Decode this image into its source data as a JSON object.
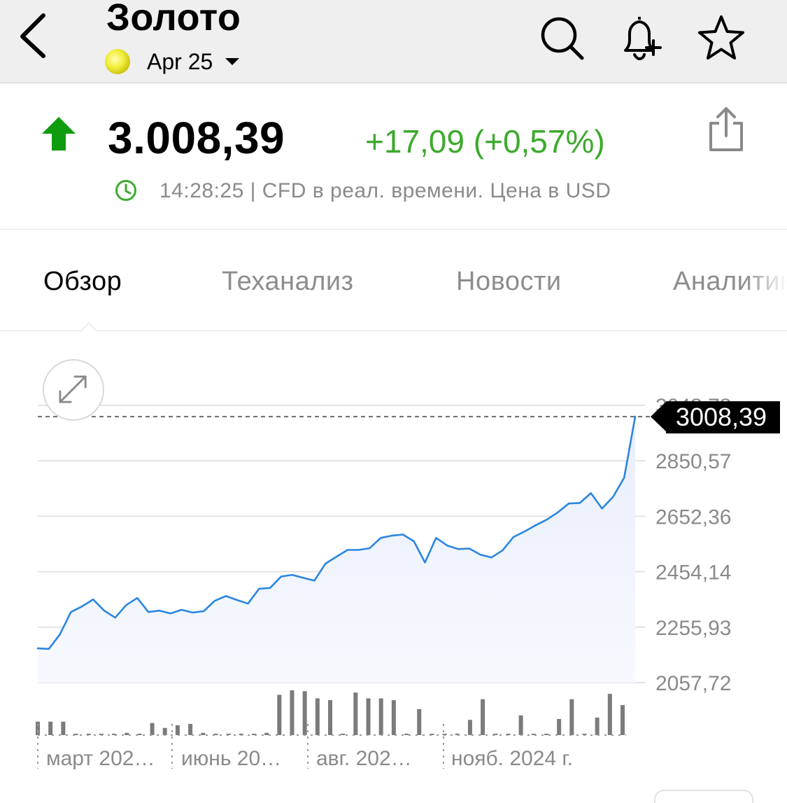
{
  "header": {
    "title": "Золото",
    "contract": "Apr 25"
  },
  "quote": {
    "price": "3.008,39",
    "change": "+17,09 (+0,57%)",
    "meta": "14:28:25 | CFD в реал. времени. Цена в USD",
    "direction": "up"
  },
  "tabs": [
    {
      "label": "Обзор",
      "active": true
    },
    {
      "label": "Теханализ",
      "active": false
    },
    {
      "label": "Новости",
      "active": false
    },
    {
      "label": "Аналитика",
      "active": false
    }
  ],
  "colors": {
    "up": "#3daa2d",
    "arrow": "#0f9d0f",
    "line": "#2a86e0",
    "volume": "#7b7b7b",
    "badge": "#000000"
  },
  "chart_data": {
    "type": "line",
    "current_value": 3008.39,
    "current_label": "3008,39",
    "y_ticks": [
      {
        "value": 3048.78,
        "label": "3048,78"
      },
      {
        "value": 2850.57,
        "label": "2850,57"
      },
      {
        "value": 2652.36,
        "label": "2652,36"
      },
      {
        "value": 2454.14,
        "label": "2454,14"
      },
      {
        "value": 2255.93,
        "label": "2255,93"
      },
      {
        "value": 2057.72,
        "label": "2057,72"
      }
    ],
    "ylim": [
      2057.72,
      3048.78
    ],
    "x_labels": [
      "март 202…",
      "июнь 20…",
      "авг. 202…",
      "нояб. 2024 г."
    ],
    "values": [
      2180,
      2178,
      2230,
      2310,
      2330,
      2355,
      2315,
      2290,
      2335,
      2360,
      2310,
      2315,
      2305,
      2318,
      2308,
      2313,
      2350,
      2367,
      2353,
      2340,
      2393,
      2396,
      2437,
      2443,
      2432,
      2422,
      2483,
      2508,
      2532,
      2532,
      2538,
      2575,
      2583,
      2587,
      2563,
      2487,
      2575,
      2548,
      2535,
      2537,
      2515,
      2505,
      2530,
      2578,
      2598,
      2620,
      2640,
      2666,
      2698,
      2700,
      2735,
      2680,
      2722,
      2790,
      3008.39
    ],
    "volume": [
      0.3,
      0.3,
      0.3,
      0,
      0,
      0,
      0,
      0.05,
      0,
      0.27,
      0.16,
      0.22,
      0.25,
      0.05,
      0,
      0,
      0,
      0,
      0.05,
      0.9,
      1.0,
      0.98,
      0.82,
      0.78,
      0,
      0.95,
      0.82,
      0.82,
      0.78,
      0,
      0.58,
      0,
      0,
      0,
      0.34,
      0.8,
      0,
      0,
      0.44,
      0,
      0,
      0.36,
      0.8,
      0,
      0.39,
      0.92,
      0.67
    ]
  }
}
